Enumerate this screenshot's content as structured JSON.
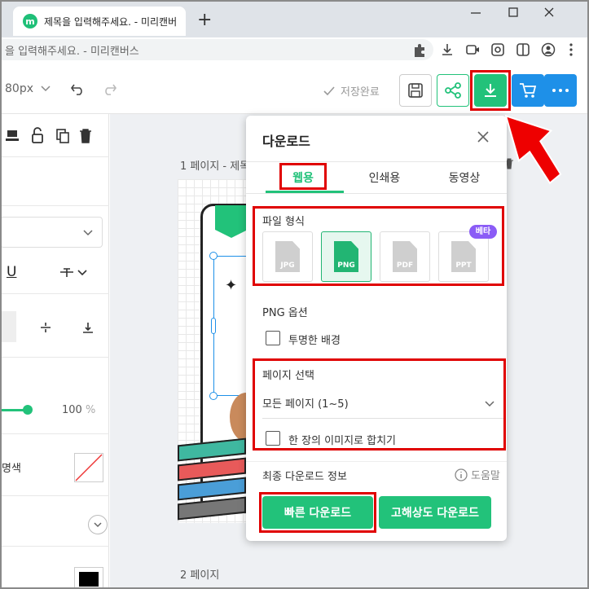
{
  "browser": {
    "tab_title": "제목을 입력해주세요. - 미리캔버",
    "favicon_letter": "m",
    "new_tab": "+",
    "url_text": "을 입력해주세요. - 미리캔버스"
  },
  "toolbar": {
    "zoom": "80px",
    "save_status": "저장완료"
  },
  "left_panel": {
    "opacity_value": "100",
    "opacity_unit": "%",
    "color_label": "명색"
  },
  "canvas": {
    "page1_label": "1 페이지 - 제목",
    "page2_label": "2 페이지"
  },
  "dialog": {
    "title": "다운로드",
    "tabs": [
      "웹용",
      "인쇄용",
      "동영상"
    ],
    "file_format_label": "파일 형식",
    "beta_badge": "베타",
    "formats": [
      "JPG",
      "PNG",
      "PDF",
      "PPT"
    ],
    "png_options_label": "PNG 옵션",
    "transparent_bg": "투명한 배경",
    "page_select_label": "페이지 선택",
    "page_select_value": "모든 페이지 (1~5)",
    "merge_label": "한 장의 이미지로 합치기",
    "final_info_label": "최종 다운로드 정보",
    "help_label": "도움말",
    "quick_download": "빠른 다운로드",
    "hires_download": "고해상도 다운로드"
  },
  "colors": {
    "accent_green": "#22c27a",
    "accent_blue": "#1e90e8",
    "highlight_red": "#e00000"
  }
}
